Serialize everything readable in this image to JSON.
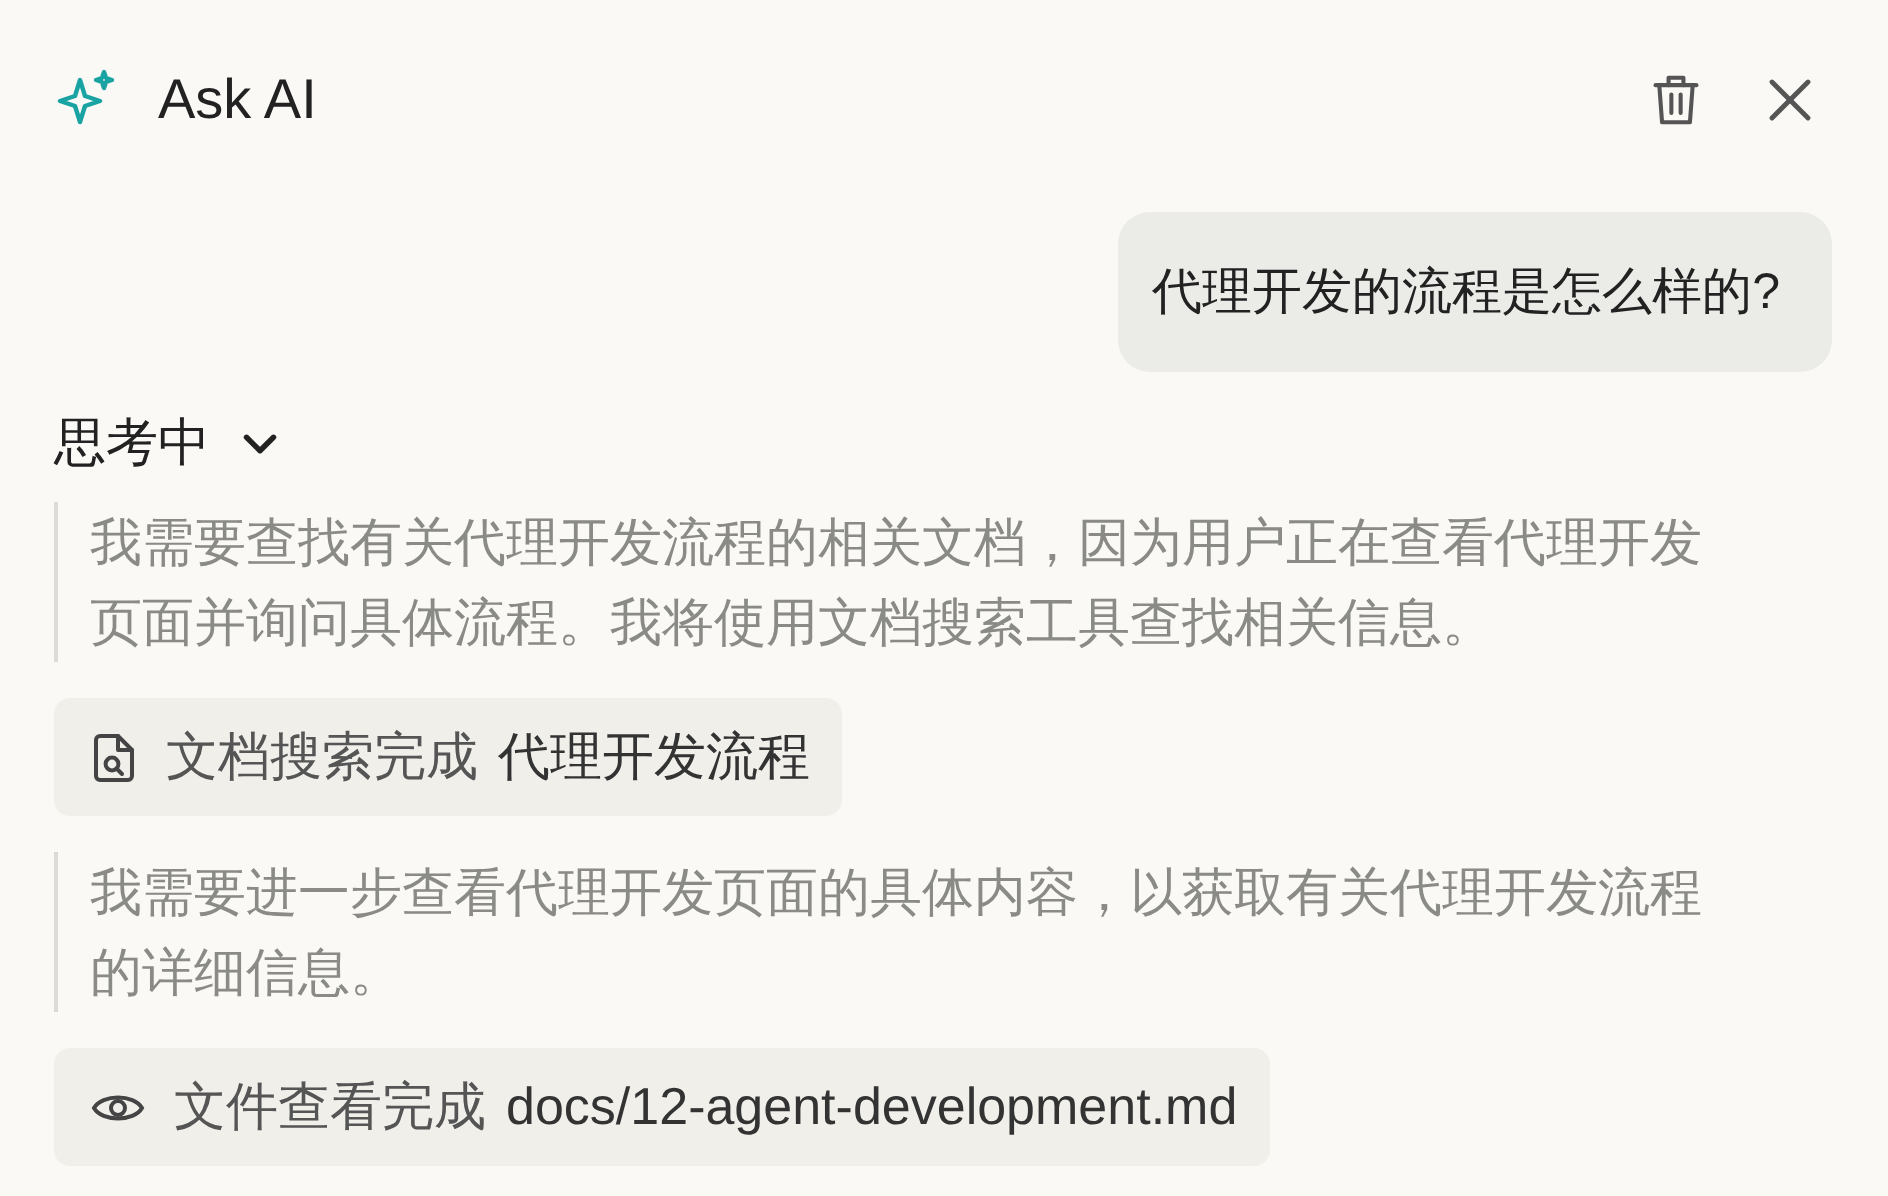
{
  "header": {
    "title": "Ask AI"
  },
  "messages": [
    {
      "kind": "user",
      "text": "代理开发的流程是怎么样的?"
    }
  ],
  "thinking": {
    "label": "思考中",
    "expanded": true,
    "steps": [
      {
        "kind": "thought",
        "text": "我需要查找有关代理开发流程的相关文档，因为用户正在查看代理开发页面并询问具体流程。我将使用文档搜索工具查找相关信息。"
      },
      {
        "kind": "search_result",
        "status": "文档搜索完成",
        "target": "代理开发流程"
      },
      {
        "kind": "thought",
        "text": "我需要进一步查看代理开发页面的具体内容，以获取有关代理开发流程的详细信息。"
      },
      {
        "kind": "view_result",
        "status": "文件查看完成",
        "target": "docs/12-agent-development.md"
      }
    ]
  }
}
